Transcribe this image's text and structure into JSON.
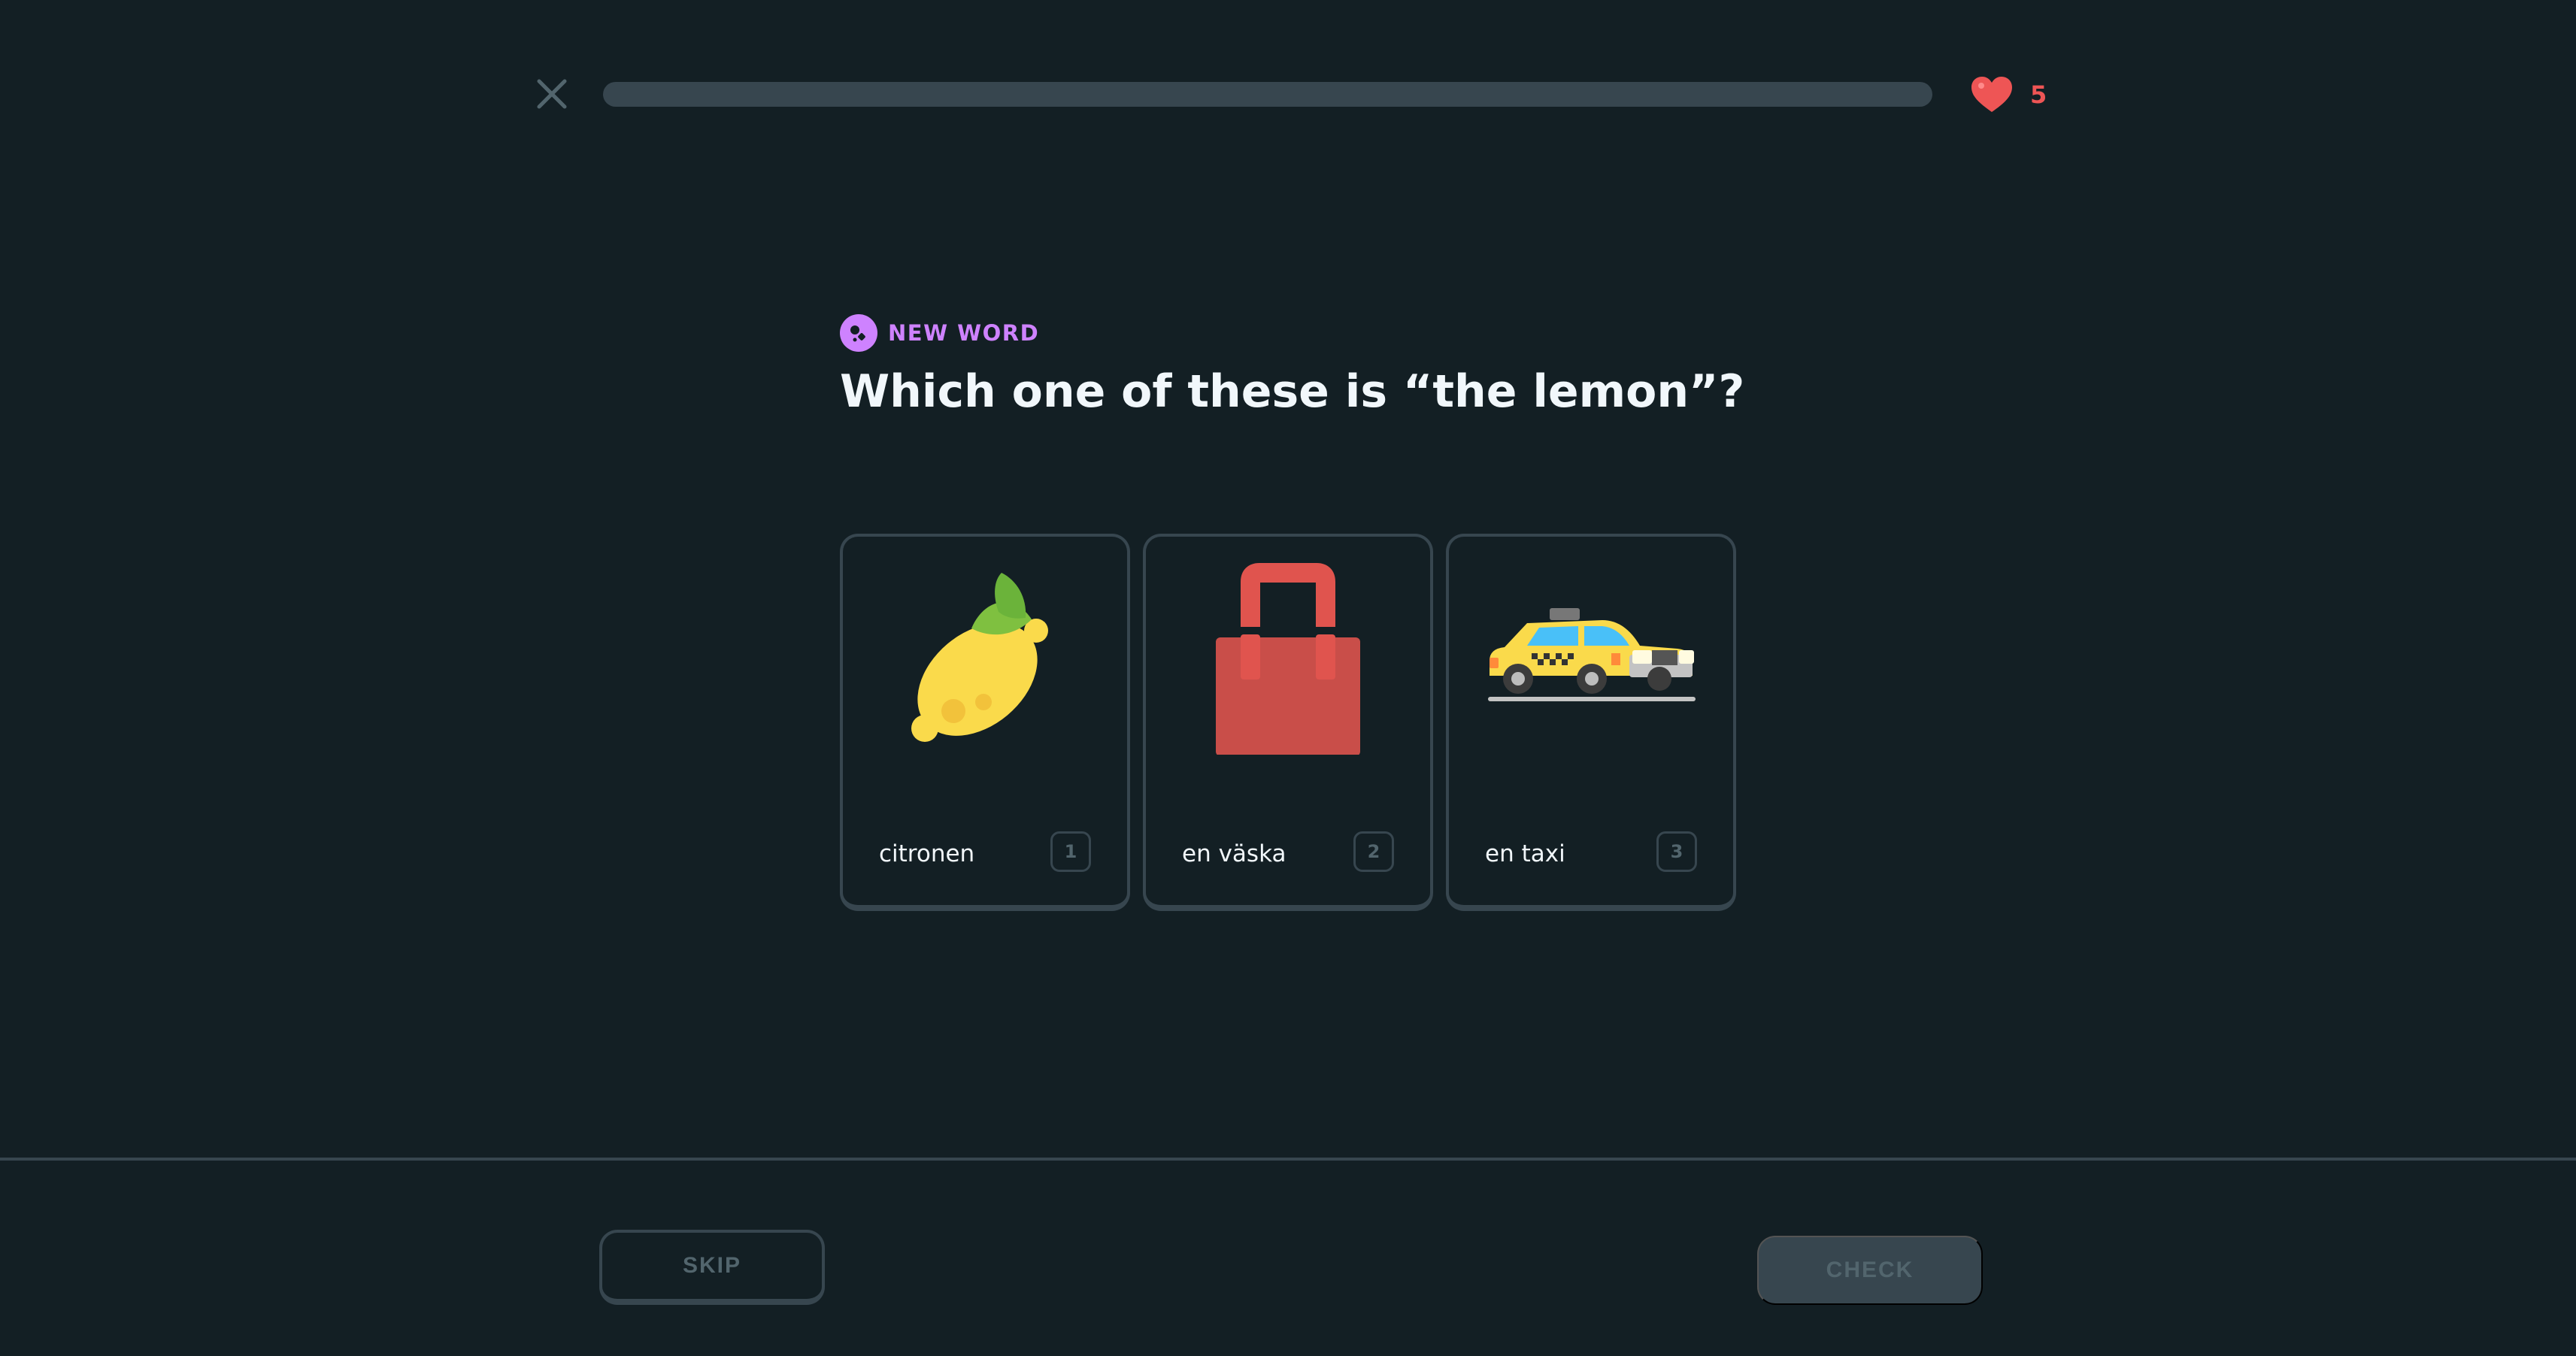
{
  "header": {
    "close_icon": "close-icon",
    "progress_fraction": 0.0,
    "hearts_count": "5",
    "heart_color": "#ee5555"
  },
  "prompt": {
    "badge_label": "NEW WORD",
    "badge_color": "#ce82ff",
    "question": "Which one of these is “the lemon”?"
  },
  "choices": [
    {
      "label": "citronen",
      "key": "1",
      "icon": "lemon-icon"
    },
    {
      "label": "en väska",
      "key": "2",
      "icon": "bag-icon"
    },
    {
      "label": "en taxi",
      "key": "3",
      "icon": "taxi-icon"
    }
  ],
  "footer": {
    "skip_label": "SKIP",
    "check_label": "CHECK"
  }
}
